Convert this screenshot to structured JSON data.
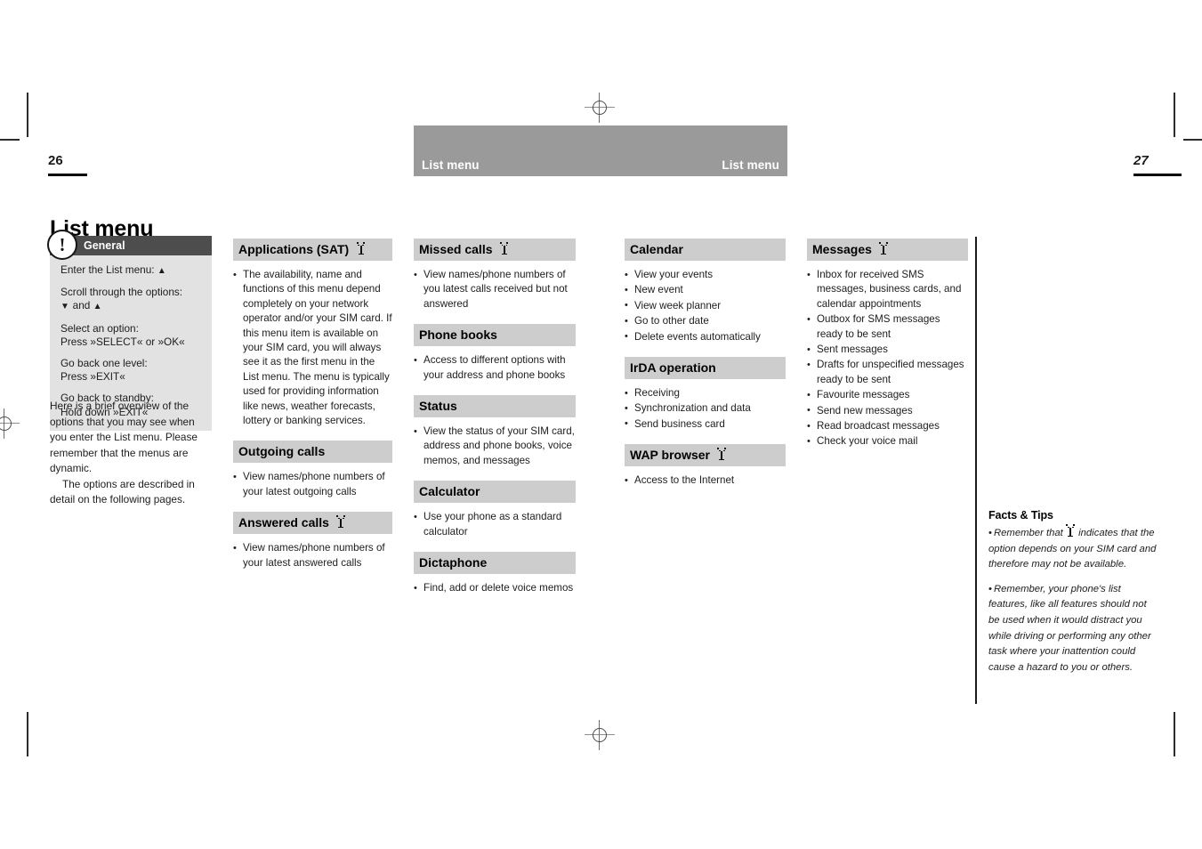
{
  "printer_marks": {
    "registration_icon": "registration-crosshair",
    "crop_icon": "crop-mark"
  },
  "header": {
    "left_title": "List menu",
    "right_title": "List menu"
  },
  "folio": {
    "left_page": "26",
    "right_page": "27"
  },
  "page_title": "List menu",
  "general_box": {
    "badge_glyph": "!",
    "title": "General",
    "lines": [
      "Enter the List menu:  ▲",
      "Scroll through the options:\n ▼  and  ▲",
      "Select an option:\nPress »SELECT« or »OK«",
      "Go back one level:\nPress »EXIT«",
      "Go back to standby:\nHold down »EXIT«"
    ]
  },
  "intro": {
    "paragraph_1": "Here is a brief overview of the options that you may see when you enter the List menu. Please remember that the menus are dynamic.",
    "paragraph_2": "The options are described in detail on the following pages."
  },
  "columns": [
    {
      "sections": [
        {
          "title": "Applications (SAT)",
          "sat_icon": true,
          "items": [
            "The availability, name and functions of this menu depend completely on your network operator and/or your SIM card. If this menu item is available on your SIM card, you will always see it as the first menu in the List menu. The menu is typically used for providing information like news, weather forecasts, lottery or banking services."
          ]
        },
        {
          "title": "Outgoing calls",
          "sat_icon": false,
          "items": [
            "View names/phone numbers of your latest outgoing calls"
          ]
        },
        {
          "title": "Answered calls",
          "sat_icon": true,
          "items": [
            "View names/phone numbers of your latest answered calls"
          ]
        }
      ]
    },
    {
      "sections": [
        {
          "title": "Missed calls",
          "sat_icon": true,
          "items": [
            "View names/phone numbers of you latest calls received but not answered"
          ]
        },
        {
          "title": "Phone books",
          "sat_icon": false,
          "items": [
            "Access to different options with your address and phone books"
          ]
        },
        {
          "title": "Status",
          "sat_icon": false,
          "items": [
            "View the status of your SIM card, address and phone books, voice memos, and messages"
          ]
        },
        {
          "title": "Calculator",
          "sat_icon": false,
          "items": [
            "Use your phone as a standard calculator"
          ]
        },
        {
          "title": "Dictaphone",
          "sat_icon": false,
          "items": [
            "Find, add or delete voice memos"
          ]
        }
      ]
    },
    {
      "sections": [
        {
          "title": "Calendar",
          "sat_icon": false,
          "items": [
            "View your events",
            "New event",
            "View week planner",
            "Go to other date",
            "Delete events automatically"
          ]
        },
        {
          "title": "IrDA operation",
          "sat_icon": false,
          "items": [
            "Receiving",
            "Synchronization and data",
            "Send business card"
          ]
        },
        {
          "title": "WAP browser",
          "sat_icon": true,
          "items": [
            "Access to the Internet"
          ]
        }
      ]
    },
    {
      "sections": [
        {
          "title": "Messages",
          "sat_icon": true,
          "items": [
            "Inbox for received SMS messages, business cards, and calendar appointments",
            "Outbox for SMS messages ready to be sent",
            "Sent messages",
            "Drafts for unspecified messages ready to be sent",
            "Favourite messages",
            "Send new messages",
            "Read broadcast messages",
            "Check your voice mail"
          ]
        }
      ]
    }
  ],
  "facts_tips": {
    "title": "Facts & Tips",
    "bullet_glyph": "•",
    "tip_1_before": "Remember that",
    "tip_1_after": "indicates that the option depends on your SIM card and therefore may not be available.",
    "tip_2": "Remember, your phone's list features, like all features should not be used when it would distract you while driving or performing any other task where your inattention could cause a hazard to you or others."
  },
  "colors": {
    "header_bar": "#9a9a9a",
    "section_heading_bg": "#cdcdcd",
    "general_head_bg": "#4d4d4d",
    "general_body_bg": "#e2e2e2",
    "text": "#1d1d1d"
  }
}
